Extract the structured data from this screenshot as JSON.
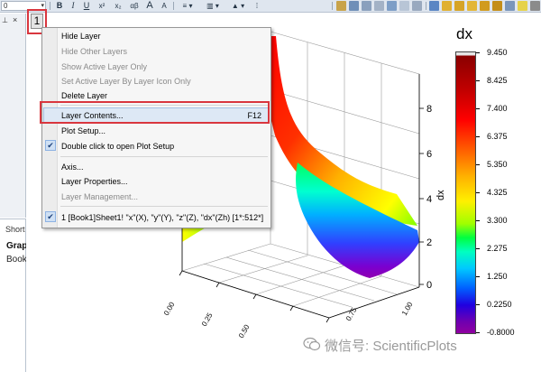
{
  "toolbar": {
    "font_size": "0",
    "bold": "B",
    "italic": "I",
    "underline": "U",
    "superscript": "x²",
    "subscript": "x₂",
    "greek": "αβ",
    "increase_font": "A",
    "decrease_font": "A"
  },
  "dock": {
    "short_label": "Short",
    "graph_label": "Grap",
    "book_label": "Book"
  },
  "layer_tab": {
    "label": "1"
  },
  "menu": {
    "items": [
      {
        "label": "Hide Layer",
        "enabled": true
      },
      {
        "label": "Hide Other Layers",
        "enabled": false
      },
      {
        "label": "Show Active Layer Only",
        "enabled": false
      },
      {
        "label": "Set Active Layer By Layer Icon Only",
        "enabled": false
      },
      {
        "label": "Delete Layer",
        "enabled": true
      },
      {
        "label": "Layer Contents...",
        "shortcut": "F12",
        "enabled": true
      },
      {
        "label": "Plot Setup...",
        "enabled": true
      },
      {
        "label": "Double click to open Plot Setup",
        "enabled": true,
        "checked": true
      },
      {
        "label": "Axis...",
        "enabled": true
      },
      {
        "label": "Layer Properties...",
        "enabled": true
      },
      {
        "label": "Layer Management...",
        "enabled": false
      },
      {
        "label": "1    [Book1]Sheet1! \"x\"(X), \"y\"(Y), \"z\"(Z), \"dx\"(Zh) [1*:512*]",
        "enabled": true,
        "checked": true
      }
    ]
  },
  "plot": {
    "z_axis_title": "dx",
    "z_ticks": [
      "8",
      "6",
      "4",
      "2",
      "0"
    ],
    "x_ticks": [
      "0.00",
      "0.25",
      "0.50",
      "0.75",
      "1.00"
    ]
  },
  "colorbar": {
    "title": "dx",
    "labels": [
      "9.450",
      "8.425",
      "7.400",
      "6.375",
      "5.350",
      "4.325",
      "3.300",
      "2.275",
      "1.250",
      "0.2250",
      "-0.8000"
    ]
  },
  "watermark": {
    "text": "微信号: ScientificPlots"
  }
}
